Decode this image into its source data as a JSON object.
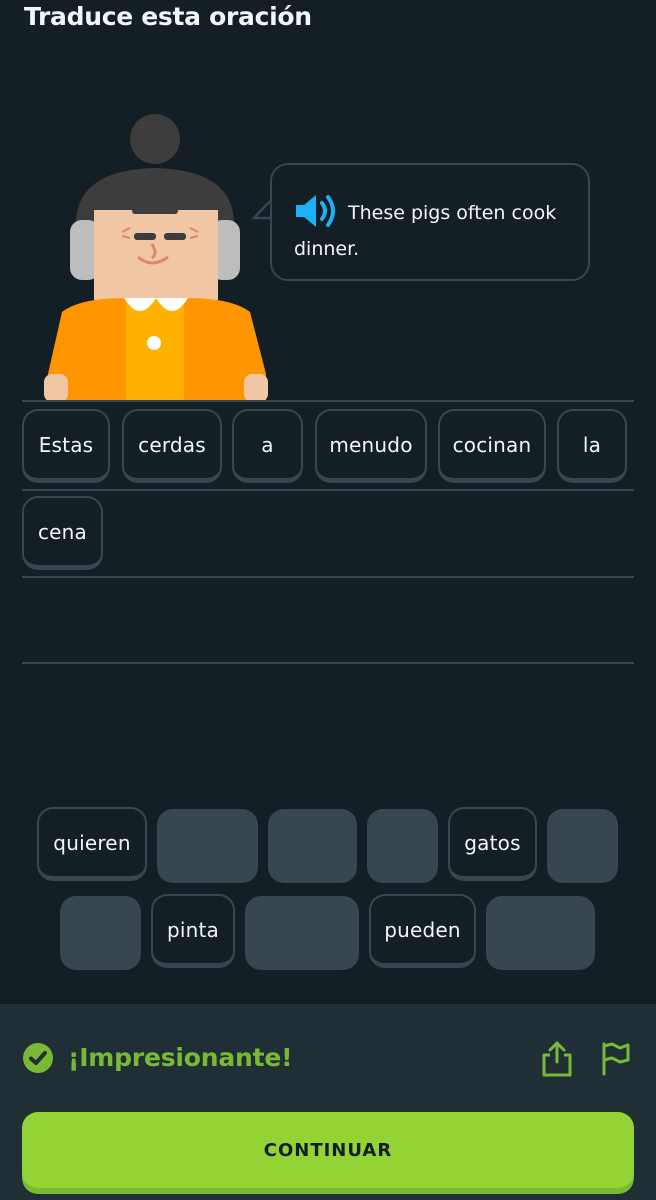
{
  "header": {
    "title": "Traduce esta oración"
  },
  "prompt": {
    "sentence": "These pigs often cook dinner.",
    "audio_icon": "speaker-icon"
  },
  "answer": {
    "tiles": [
      "Estas",
      "cerdas",
      "a",
      "menudo",
      "cocinan",
      "la",
      "cena"
    ]
  },
  "word_bank": {
    "row1": [
      "quieren",
      "",
      "",
      "",
      "gatos",
      ""
    ],
    "row2": [
      "",
      "pinta",
      "",
      "pueden",
      ""
    ]
  },
  "footer": {
    "feedback": "¡Impresionante!",
    "continue_label": "CONTINUAR",
    "icons": [
      "check-circle-icon",
      "share-icon",
      "flag-icon"
    ]
  },
  "colors": {
    "background": "#131f24",
    "footer": "#202f36",
    "border": "#37464f",
    "success_green": "#79b933",
    "button_green": "#93d333",
    "speaker_blue": "#1cb0f6"
  }
}
